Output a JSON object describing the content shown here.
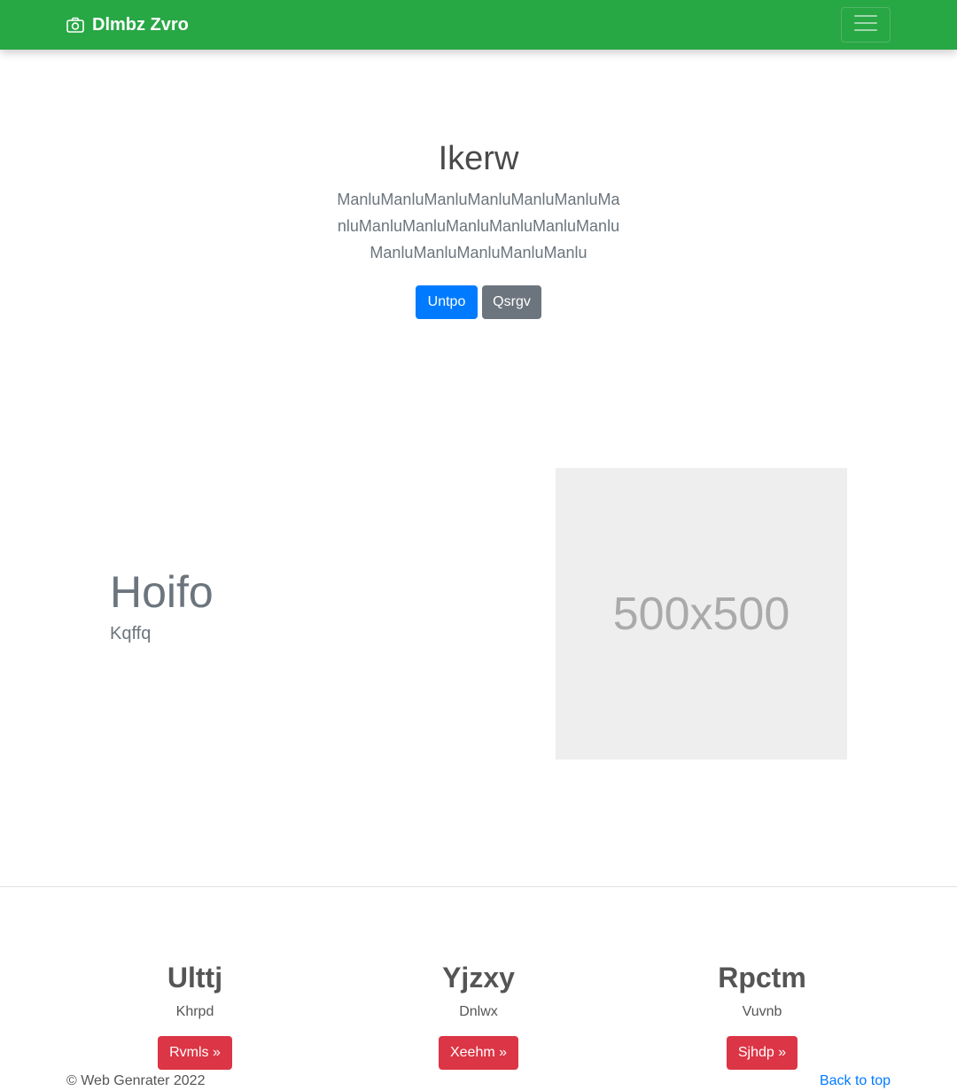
{
  "navbar": {
    "brand": "Dlmbz Zvro",
    "brand_icon": "camera-icon",
    "toggler_icon": "hamburger-menu-icon",
    "background": "#28a745"
  },
  "hero": {
    "title": "Ikerw",
    "lead": "ManluManluManluManluManluManluManluManluManluManluManluManluManluManluManluManluManluManlu",
    "primary_button": "Untpo",
    "secondary_button": "Qsrgv"
  },
  "feature": {
    "heading": "Hoifo",
    "subheading": "Kqffq",
    "image_label": "500x500"
  },
  "columns": [
    {
      "title": "Ulttj",
      "text": "Khrpd",
      "button": "Rvmls »"
    },
    {
      "title": "Yjzxy",
      "text": "Dnlwx",
      "button": "Xeehm »"
    },
    {
      "title": "Rpctm",
      "text": "Vuvnb",
      "button": "Sjhdp »"
    }
  ],
  "footer": {
    "copyright": "© Web Genrater 2022",
    "back_to_top": "Back to top"
  },
  "colors": {
    "primary": "#007bff",
    "secondary": "#6c757d",
    "danger": "#dc3545",
    "success": "#28a745"
  }
}
